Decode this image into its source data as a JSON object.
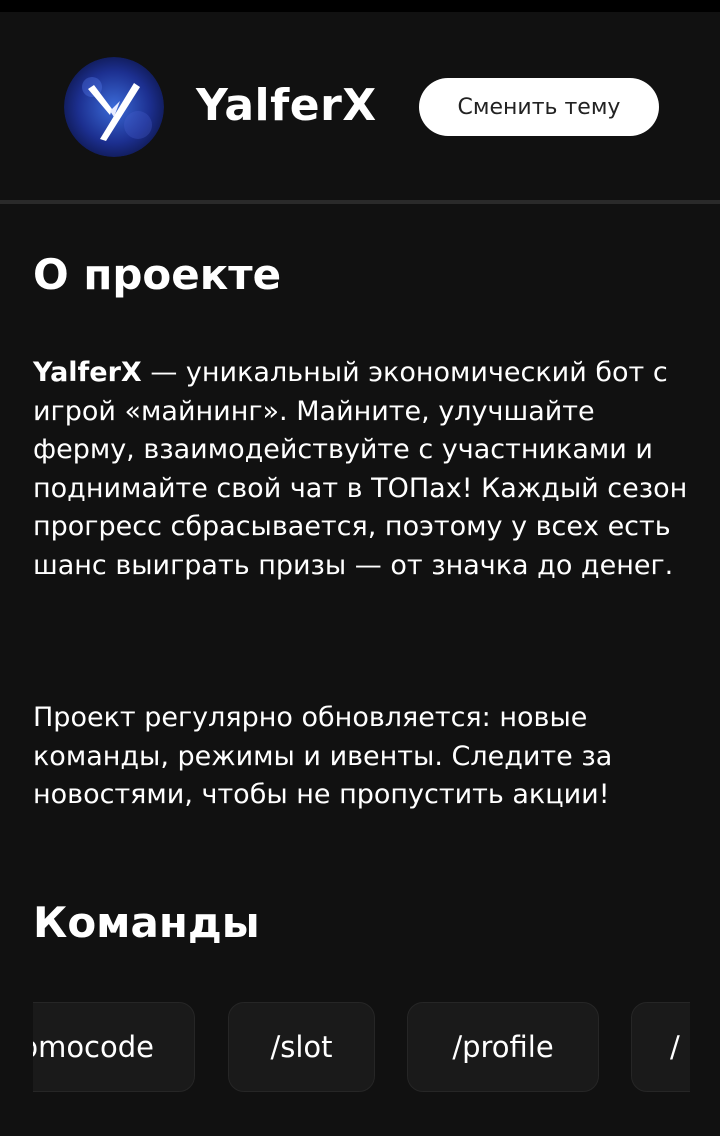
{
  "header": {
    "logo_letter": "Y",
    "brand": "YalferX",
    "theme_button": "Сменить тему"
  },
  "about": {
    "title": "О проекте",
    "p1_brand": "YalferX",
    "p1_text": " — уникальный экономический бот с игрой «майнинг». Майните, улучшайте ферму, взаимодействуйте с участниками и поднимайте свой чат в ТОПах! Каждый сезон прогресс сбрасывается, поэтому у всех есть шанс выиграть призы — от значка до денег.",
    "p2_text": "Проект регулярно обновляется: новые команды, режимы и ивенты. Следите за новостями, чтобы не пропустить акции!"
  },
  "commands": {
    "title": "Команды",
    "items": [
      "/promocode",
      "/slot",
      "/profile",
      "/"
    ]
  },
  "colors": {
    "background": "#111111",
    "card": "#1a1a1a",
    "button_bg": "#ffffff"
  }
}
